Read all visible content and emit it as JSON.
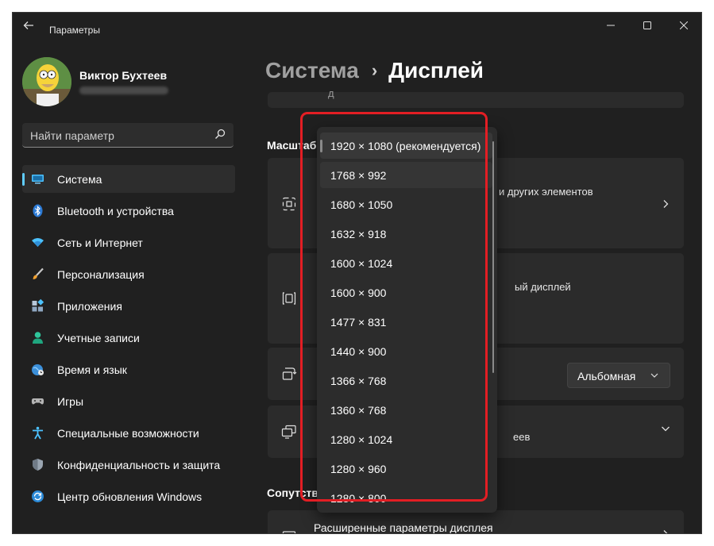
{
  "window": {
    "title": "Параметры",
    "min_icon": "minimize-icon",
    "max_icon": "maximize-icon",
    "close_icon": "close-icon"
  },
  "profile": {
    "name": "Виктор Бухтеев"
  },
  "search": {
    "placeholder": "Найти параметр"
  },
  "nav": {
    "items": [
      {
        "label": "Система",
        "icon": "display-icon",
        "active": true
      },
      {
        "label": "Bluetooth и устройства",
        "icon": "bluetooth-icon"
      },
      {
        "label": "Сеть и Интернет",
        "icon": "wifi-icon"
      },
      {
        "label": "Персонализация",
        "icon": "brush-icon"
      },
      {
        "label": "Приложения",
        "icon": "apps-icon"
      },
      {
        "label": "Учетные записи",
        "icon": "person-icon"
      },
      {
        "label": "Время и язык",
        "icon": "globe-clock-icon"
      },
      {
        "label": "Игры",
        "icon": "gamepad-icon"
      },
      {
        "label": "Специальные возможности",
        "icon": "accessibility-icon"
      },
      {
        "label": "Конфиденциальность и защита",
        "icon": "shield-icon"
      },
      {
        "label": "Центр обновления Windows",
        "icon": "update-icon"
      }
    ]
  },
  "breadcrumb": {
    "parent": "Система",
    "separator": "›",
    "current": "Дисплей"
  },
  "main": {
    "top_card_text": "д",
    "scale_section_label": "Масштаб",
    "scale_card_text": "и других элементов",
    "resolution_card_text": "ый дисплей",
    "orientation_value": "Альбомная",
    "multi_display_text": "еев",
    "related_section_label": "Сопутств",
    "advanced_display_label": "Расширенные параметры дисплея"
  },
  "resolution_dropdown": {
    "options": [
      "1920 × 1080 (рекомендуется)",
      "1768 × 992",
      "1680 × 1050",
      "1632 × 918",
      "1600 × 1024",
      "1600 × 900",
      "1477 × 831",
      "1440 × 900",
      "1366 × 768",
      "1360 × 768",
      "1280 × 1024",
      "1280 × 960",
      "1280 × 800"
    ],
    "selected": "1920 × 1080 (рекомендуется)",
    "hovered": "1768 × 992"
  },
  "colors": {
    "background": "#202020",
    "card": "#2b2b2b",
    "accent": "#60cdff",
    "highlight": "#e31e24"
  }
}
